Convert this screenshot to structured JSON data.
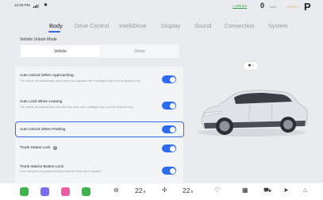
{
  "status_bar": {
    "time": "12:09 PM",
    "range": "≈ 376 km",
    "speed": "0",
    "speed_unit": "km/h",
    "ready": "READY",
    "gear": "P"
  },
  "tabs": [
    {
      "label": "Body",
      "active": true
    },
    {
      "label": "Drive Control",
      "active": false
    },
    {
      "label": "IntelliDrive",
      "active": false
    },
    {
      "label": "Display",
      "active": false
    },
    {
      "label": "Sound",
      "active": false
    },
    {
      "label": "Connection",
      "active": false
    },
    {
      "label": "System",
      "active": false
    }
  ],
  "unlock_mode": {
    "title": "Vehicle Unlock Mode",
    "options": [
      "Vehicle",
      "Driver"
    ],
    "selected": "Vehicle"
  },
  "settings": [
    {
      "title": "Auto Unlock When Approaching",
      "description": "The vehicle will automatically unlock when you approach with a intelligent key or phone Bluetooth key.",
      "enabled": true
    },
    {
      "title": "Auto Lock When Leaving",
      "description": "The vehicle will automatically lock when you leave with a intelligent key or phone Bluetooth key.",
      "enabled": true
    },
    {
      "title": "Auto Unlock When Parking",
      "description": "",
      "enabled": true
    },
    {
      "title": "Trunk Status Lock",
      "description": "",
      "enabled": true
    },
    {
      "title": "Trunk Interior Button Lock",
      "description": "Once activated, the physical buttons inside the trunk will be disabled",
      "enabled": true
    }
  ],
  "climate": {
    "left_temp": "22",
    "right_temp": "22",
    "temp_unit": ".5"
  },
  "colors": {
    "accent": "#2d6cf0",
    "toggle_on": "#2d6cf0",
    "range_green": "#2f9e45"
  },
  "dock_apps": [
    {
      "name": "app-green",
      "color": "#3bb54a"
    },
    {
      "name": "app-purple",
      "color": "#7a6cf2"
    },
    {
      "name": "app-pink",
      "color": "#e95ca4"
    },
    {
      "name": "app-phone",
      "color": "#3bb54a"
    }
  ]
}
